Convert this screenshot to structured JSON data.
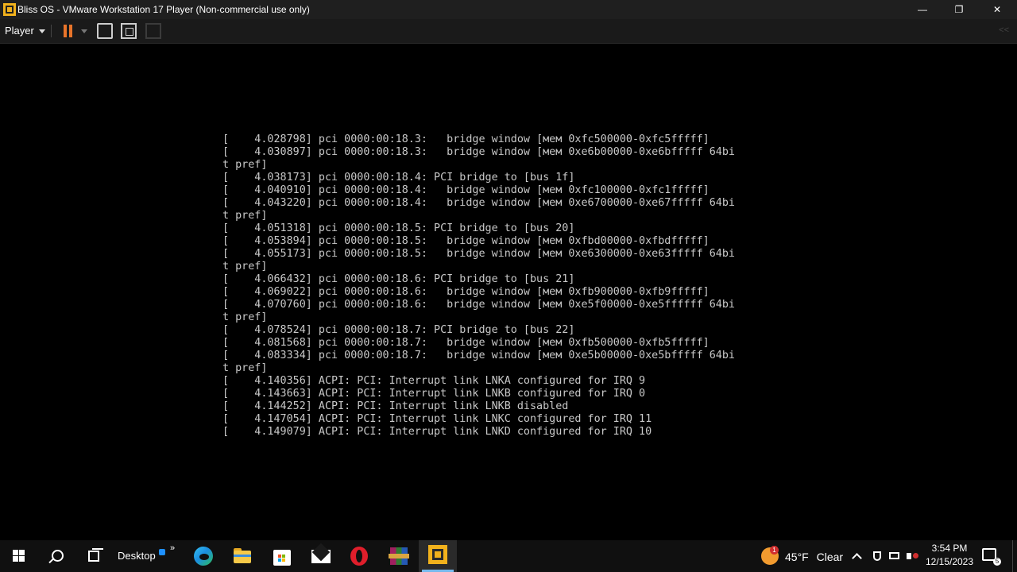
{
  "window": {
    "title": "Bliss OS - VMware Workstation 17 Player (Non-commercial use only)",
    "minimize_glyph": "—",
    "maximize_glyph": "❐",
    "close_glyph": "✕"
  },
  "toolbar": {
    "player_label": "Player",
    "icons": [
      "pause-icon",
      "send-ctrl-alt-del-icon",
      "full-screen-icon",
      "unity-icon",
      "collapse-toolbar-icon"
    ],
    "accent": "#e8742a"
  },
  "console": {
    "lines": [
      "[    4.028798] pci 0000:00:18.3:   bridge window [мем 0xfc500000-0xfc5fffff]",
      "[    4.030897] pci 0000:00:18.3:   bridge window [мем 0xe6b00000-0xe6bfffff 64bi",
      "t pref]",
      "[    4.038173] pci 0000:00:18.4: PCI bridge to [bus 1f]",
      "[    4.040910] pci 0000:00:18.4:   bridge window [мем 0xfc100000-0xfc1fffff]",
      "[    4.043220] pci 0000:00:18.4:   bridge window [мем 0xe6700000-0xe67fffff 64bi",
      "t pref]",
      "[    4.051318] pci 0000:00:18.5: PCI bridge to [bus 20]",
      "[    4.053894] pci 0000:00:18.5:   bridge window [мем 0xfbd00000-0xfbdfffff]",
      "[    4.055173] pci 0000:00:18.5:   bridge window [мем 0xe6300000-0xe63fffff 64bi",
      "t pref]",
      "[    4.066432] pci 0000:00:18.6: PCI bridge to [bus 21]",
      "[    4.069022] pci 0000:00:18.6:   bridge window [мем 0xfb900000-0xfb9fffff]",
      "[    4.070760] pci 0000:00:18.6:   bridge window [мем 0xe5f00000-0xe5ffffff 64bi",
      "t pref]",
      "[    4.078524] pci 0000:00:18.7: PCI bridge to [bus 22]",
      "[    4.081568] pci 0000:00:18.7:   bridge window [мем 0xfb500000-0xfb5fffff]",
      "[    4.083334] pci 0000:00:18.7:   bridge window [мем 0xe5b00000-0xe5bfffff 64bi",
      "t pref]",
      "[    4.140356] ACPI: PCI: Interrupt link LNKA configured for IRQ 9",
      "[    4.143663] ACPI: PCI: Interrupt link LNKB configured for IRQ 0",
      "[    4.144252] ACPI: PCI: Interrupt link LNKB disabled",
      "[    4.147054] ACPI: PCI: Interrupt link LNKC configured for IRQ 11",
      "[    4.149079] ACPI: PCI: Interrupt link LNKD configured for IRQ 10"
    ]
  },
  "taskbar": {
    "desktop_label": "Desktop",
    "desktop_more": "»",
    "pinned_apps": [
      "start",
      "search",
      "task-view",
      "edge",
      "file-explorer",
      "microsoft-store",
      "mail",
      "opera",
      "winrar",
      "vmware-player"
    ],
    "active_app": "vmware-player",
    "weather": {
      "badge": "1",
      "temp": "45°F",
      "condition": "Clear"
    },
    "clock": {
      "time": "3:54 PM",
      "date": "12/15/2023"
    },
    "notification_badge": "5"
  }
}
